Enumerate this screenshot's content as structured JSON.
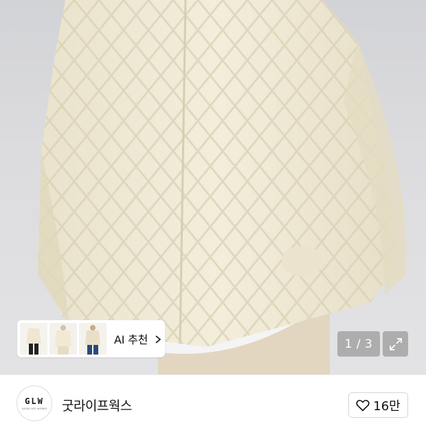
{
  "product_image": {
    "description_icon": "sweater-photo"
  },
  "ai_recommend": {
    "label": "AI 추천",
    "thumbnail_icons": [
      "cardigan-thumb-1",
      "cardigan-thumb-2",
      "cardigan-thumb-3"
    ]
  },
  "gallery": {
    "counter": "1 / 3",
    "expand_icon": "expand-icon"
  },
  "brand": {
    "logo_mark": "GLW",
    "logo_sub": "GOOD LIFE WORKS",
    "name": "굿라이프웍스"
  },
  "like": {
    "count": "16만",
    "icon": "heart-icon"
  },
  "colors": {
    "sweater": "#f1ecd9",
    "background": "#d9d9dc",
    "overlay": "#8a8a8a"
  }
}
